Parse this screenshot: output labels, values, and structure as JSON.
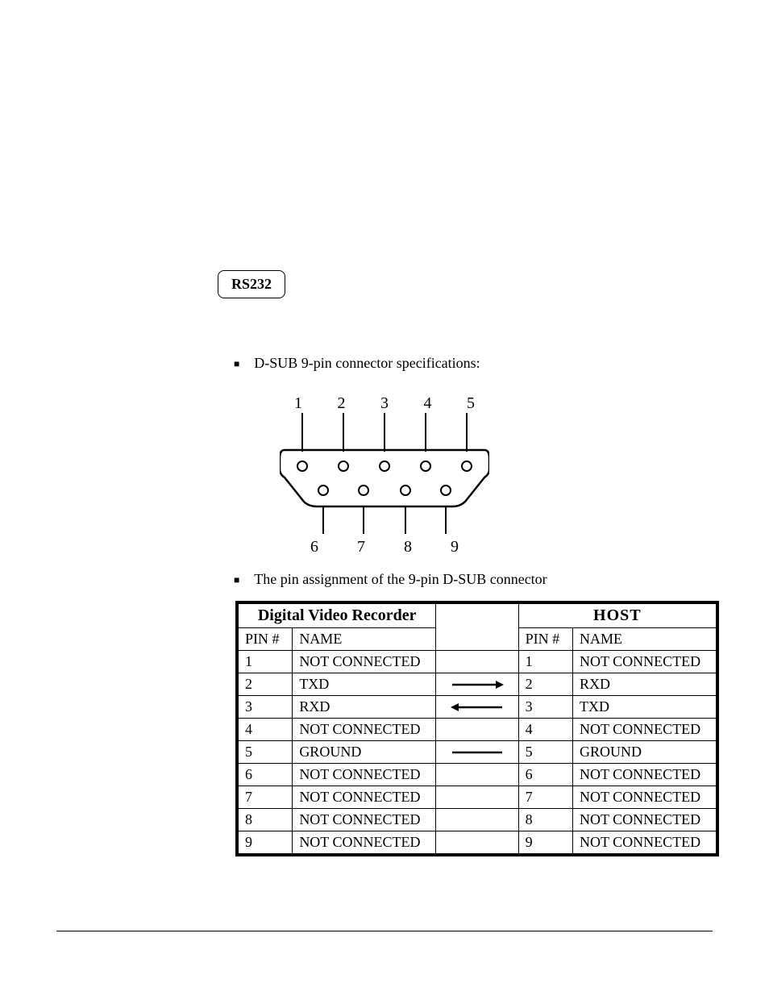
{
  "heading": "RS232",
  "bullets": [
    "D-SUB 9-pin connector specifications:",
    "The pin assignment of the 9-pin D-SUB connector"
  ],
  "dsub": {
    "top_pins": [
      "1",
      "2",
      "3",
      "4",
      "5"
    ],
    "bottom_pins": [
      "6",
      "7",
      "8",
      "9"
    ]
  },
  "table": {
    "left_title": "Digital Video Recorder",
    "right_title": "HOST",
    "col_pin": "PIN #",
    "col_name": "NAME",
    "rows": [
      {
        "lp": "1",
        "ln": "NOT CONNECTED",
        "arrow": "none",
        "rp": "1",
        "rn": "NOT CONNECTED"
      },
      {
        "lp": "2",
        "ln": "TXD",
        "arrow": "right",
        "rp": "2",
        "rn": "RXD"
      },
      {
        "lp": "3",
        "ln": "RXD",
        "arrow": "left",
        "rp": "3",
        "rn": "TXD"
      },
      {
        "lp": "4",
        "ln": "NOT CONNECTED",
        "arrow": "none",
        "rp": "4",
        "rn": "NOT CONNECTED"
      },
      {
        "lp": "5",
        "ln": "GROUND",
        "arrow": "line",
        "rp": "5",
        "rn": "GROUND"
      },
      {
        "lp": "6",
        "ln": "NOT CONNECTED",
        "arrow": "none",
        "rp": "6",
        "rn": "NOT CONNECTED"
      },
      {
        "lp": "7",
        "ln": "NOT CONNECTED",
        "arrow": "none",
        "rp": "7",
        "rn": "NOT CONNECTED"
      },
      {
        "lp": "8",
        "ln": "NOT CONNECTED",
        "arrow": "none",
        "rp": "8",
        "rn": "NOT CONNECTED"
      },
      {
        "lp": "9",
        "ln": "NOT CONNECTED",
        "arrow": "none",
        "rp": "9",
        "rn": "NOT CONNECTED"
      }
    ]
  }
}
